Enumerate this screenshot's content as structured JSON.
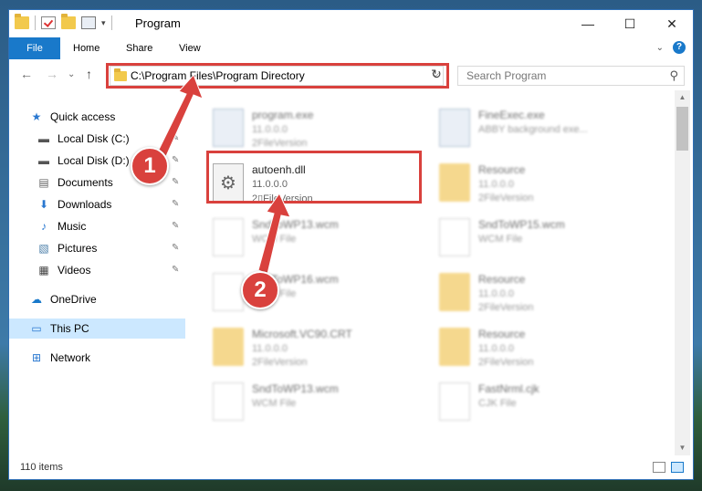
{
  "window": {
    "title": "Program",
    "controls": {
      "minimize": "—",
      "maximize": "☐",
      "close": "✕"
    }
  },
  "ribbon": {
    "tabs": [
      {
        "label": "File"
      },
      {
        "label": "Home"
      },
      {
        "label": "Share"
      },
      {
        "label": "View"
      }
    ],
    "help_label": "?"
  },
  "nav": {
    "back": "←",
    "forward": "→",
    "recent": "⌄",
    "up": "↑",
    "address": "C:\\Program Files\\Program Directory",
    "address_dropdown": "⌵",
    "refresh": "↻",
    "search_placeholder": "Search Program",
    "search_icon": "⚲"
  },
  "sidebar": {
    "items": [
      {
        "label": "Quick access",
        "icon": "★"
      },
      {
        "label": "Local Disk (C:)",
        "icon": "▬",
        "pin": "📌"
      },
      {
        "label": "Local Disk (D:)",
        "icon": "▬",
        "pin": "📌"
      },
      {
        "label": "Documents",
        "icon": "▤",
        "pin": "📌"
      },
      {
        "label": "Downloads",
        "icon": "⬇",
        "pin": "📌"
      },
      {
        "label": "Music",
        "icon": "♪",
        "pin": "📌"
      },
      {
        "label": "Pictures",
        "icon": "▧",
        "pin": "📌"
      },
      {
        "label": "Videos",
        "icon": "▦",
        "pin": "📌"
      },
      {
        "label": "OneDrive",
        "icon": "☁"
      },
      {
        "label": "This PC",
        "icon": "▭"
      },
      {
        "label": "Network",
        "icon": "⊞"
      }
    ]
  },
  "files": [
    {
      "name": "program.exe",
      "line1": "11.0.0.0",
      "line2": "2FileVersion",
      "kind": "exe"
    },
    {
      "name": "FineExec.exe",
      "line1": "ABBY background exe...",
      "line2": "",
      "kind": "exe"
    },
    {
      "name": "autoenh.dll",
      "line1": "11.0.0.0",
      "line2": "2▯FileVersion",
      "kind": "dll"
    },
    {
      "name": "Resource",
      "line1": "11.0.0.0",
      "line2": "2FileVersion",
      "kind": "folder"
    },
    {
      "name": "SndToWP13.wcm",
      "line1": "WCM File",
      "line2": "",
      "kind": "doc"
    },
    {
      "name": "SndToWP15.wcm",
      "line1": "WCM File",
      "line2": "",
      "kind": "doc"
    },
    {
      "name": "SndToWP16.wcm",
      "line1": "WCM File",
      "line2": "",
      "kind": "doc"
    },
    {
      "name": "Resource",
      "line1": "11.0.0.0",
      "line2": "2FileVersion",
      "kind": "folder"
    },
    {
      "name": "Microsoft.VC90.CRT",
      "line1": "11.0.0.0",
      "line2": "2FileVersion",
      "kind": "folder"
    },
    {
      "name": "Resource",
      "line1": "11.0.0.0",
      "line2": "2FileVersion",
      "kind": "folder"
    },
    {
      "name": "SndToWP13.wcm",
      "line1": "WCM File",
      "line2": "",
      "kind": "doc"
    },
    {
      "name": "FastNrml.cjk",
      "line1": "CJK File",
      "line2": "",
      "kind": "doc"
    }
  ],
  "status": {
    "count": "110 items"
  },
  "annotations": {
    "step1": "1",
    "step2": "2",
    "color": "#d9413d"
  }
}
